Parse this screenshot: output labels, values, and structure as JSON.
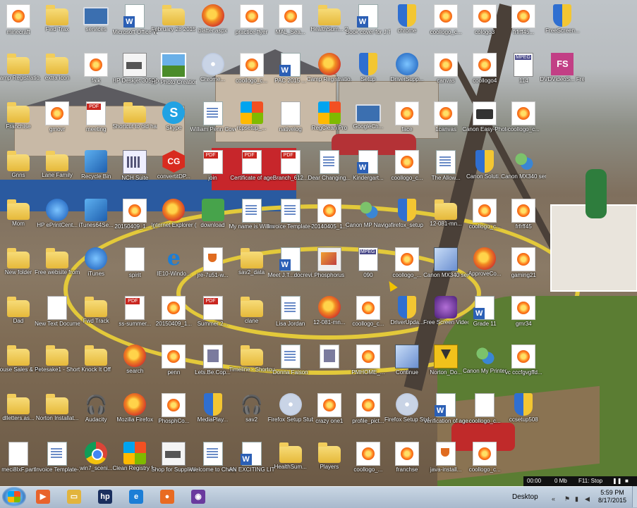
{
  "desktop": {
    "icons": [
      {
        "label": "minecraft",
        "icon": "coollogo-icon"
      },
      {
        "label": "Fwd Trax",
        "icon": "folder-icon"
      },
      {
        "label": "services",
        "icon": "monitor-icon"
      },
      {
        "label": "Microsoft Office Wo...",
        "icon": "word-icon"
      },
      {
        "label": "February 28 2015 Week...",
        "icon": "folder-icon"
      },
      {
        "label": "blatter.aspx",
        "icon": "firefox-icon"
      },
      {
        "label": "practice flyer",
        "icon": "coollogo-icon"
      },
      {
        "label": "MAL_Sea...",
        "icon": "coollogo-icon"
      },
      {
        "label": "HealthSum... 2",
        "icon": "folder-icon"
      },
      {
        "label": "Book cover for J.T. Hop...",
        "icon": "word-icon"
      },
      {
        "label": "chrome",
        "icon": "shield-icon"
      },
      {
        "label": "coollogo_c...",
        "icon": "coollogo-icon"
      },
      {
        "label": "cologo3",
        "icon": "coollogo-icon"
      },
      {
        "label": "frfrff45...",
        "icon": "coollogo-icon"
      },
      {
        "label": "FreeScreen...",
        "icon": "shield-icon"
      },
      {
        "label": "Camp Registratio...",
        "icon": "folder-icon"
      },
      {
        "label": "extra icon",
        "icon": "folder-icon"
      },
      {
        "label": "falk",
        "icon": "coollogo-icon"
      },
      {
        "label": "HP Deskjet 3050A J6...",
        "icon": "printer-icon"
      },
      {
        "label": "HP Photo Creations",
        "icon": "picture-icon"
      },
      {
        "label": "Chrome...",
        "icon": "disc-icon"
      },
      {
        "label": "coollogo_c...",
        "icon": "coollogo-icon"
      },
      {
        "label": "PAC 2015 ...",
        "icon": "word-icon"
      },
      {
        "label": "Camp Registratio...",
        "icon": "firefox-icon"
      },
      {
        "label": "Setup",
        "icon": "shield-icon"
      },
      {
        "label": "DriverSupp...",
        "icon": "blue-icon"
      },
      {
        "label": "canvas",
        "icon": "coollogo-icon"
      },
      {
        "label": "coollogo4",
        "icon": "coollogo-icon"
      },
      {
        "label": "114",
        "icon": "mpeg-icon"
      },
      {
        "label": "DVDVideoS... Free Studio",
        "icon": "pink-icon"
      },
      {
        "label": "Franchise",
        "icon": "folder-icon"
      },
      {
        "label": "gmovr",
        "icon": "coollogo-icon"
      },
      {
        "label": "meeting",
        "icon": "pdf-icon"
      },
      {
        "label": "Shortcut to old hard...",
        "icon": "folder-icon"
      },
      {
        "label": "Skype",
        "icon": "skype-icon"
      },
      {
        "label": "William Penn Cove...",
        "icon": "doc-icon"
      },
      {
        "label": "rcpsetup_...",
        "icon": "winlogo-icon"
      },
      {
        "label": "nativelog",
        "icon": "blankdoc-icon"
      },
      {
        "label": "RegClean Pro",
        "icon": "winlogo-icon"
      },
      {
        "label": "GoogleCh...",
        "icon": "monitor-icon"
      },
      {
        "label": "face",
        "icon": "coollogo-icon"
      },
      {
        "label": "1canvas",
        "icon": "coollogo-icon"
      },
      {
        "label": "Canon Easy-Photo...",
        "icon": "canon-icon"
      },
      {
        "label": "coollogo_c...",
        "icon": "coollogo-icon"
      },
      {
        "label": "",
        "icon": "none"
      },
      {
        "label": "Gnns",
        "icon": "folder-icon"
      },
      {
        "label": "Lane Family",
        "icon": "folder-icon"
      },
      {
        "label": "Recycle Bin",
        "icon": "exe-icon"
      },
      {
        "label": "NCH Suite",
        "icon": "calc-icon"
      },
      {
        "label": "convertitDP...",
        "icon": "cg-icon"
      },
      {
        "label": "join",
        "icon": "pdf-icon"
      },
      {
        "label": "Certificate of age",
        "icon": "pdf-icon"
      },
      {
        "label": "Branch_612...",
        "icon": "pdf-icon"
      },
      {
        "label": "Dear Changing...",
        "icon": "doc-icon"
      },
      {
        "label": "Kindergart...",
        "icon": "word-icon"
      },
      {
        "label": "coollogo_c...",
        "icon": "coollogo-icon"
      },
      {
        "label": "The Allow...",
        "icon": "doc-icon"
      },
      {
        "label": "Canon Soluti...",
        "icon": "shield-icon"
      },
      {
        "label": "Canon MX340 seri...",
        "icon": "people-icon"
      },
      {
        "label": "",
        "icon": "none"
      },
      {
        "label": "Mom",
        "icon": "folder-icon"
      },
      {
        "label": "HP ePrintCent...",
        "icon": "blue-icon"
      },
      {
        "label": "iTunes64Se...",
        "icon": "exe-icon"
      },
      {
        "label": "20150409_1... 1",
        "icon": "coollogo-icon"
      },
      {
        "label": "Internet Explorer (n...",
        "icon": "firefox-icon"
      },
      {
        "label": "download",
        "icon": "green-icon"
      },
      {
        "label": "My name is William Pe...",
        "icon": "doc-icon"
      },
      {
        "label": "Invoice Template-1",
        "icon": "doc-icon"
      },
      {
        "label": "20140405_1...",
        "icon": "coollogo-icon"
      },
      {
        "label": "Canon MP Navigator...",
        "icon": "people-icon"
      },
      {
        "label": "firefox_setup",
        "icon": "shield-icon"
      },
      {
        "label": "12-081-mn...",
        "icon": "folder-icon"
      },
      {
        "label": "coollogo_c...",
        "icon": "coollogo-icon"
      },
      {
        "label": "frfrff45",
        "icon": "coollogo-icon"
      },
      {
        "label": "",
        "icon": "none"
      },
      {
        "label": "New folder",
        "icon": "folder-icon"
      },
      {
        "label": "Free website from online",
        "icon": "folder-icon"
      },
      {
        "label": "iTunes",
        "icon": "blue-icon"
      },
      {
        "label": "spirit",
        "icon": "blankdoc-icon"
      },
      {
        "label": "IE10-Windo...",
        "icon": "ie-icon"
      },
      {
        "label": "jre-7u51-w...",
        "icon": "java-icon"
      },
      {
        "label": "sav2_data",
        "icon": "folder-icon"
      },
      {
        "label": "Meet J.T...docrevi...",
        "icon": "word-icon"
      },
      {
        "label": "Phosphorus",
        "icon": "image-icon"
      },
      {
        "label": "090",
        "icon": "mpeg-icon"
      },
      {
        "label": "coollogo_...",
        "icon": "coollogo-icon"
      },
      {
        "label": "Canon MX340 seri...",
        "icon": "net-icon"
      },
      {
        "label": "ApproveCo...",
        "icon": "firefox-icon"
      },
      {
        "label": "gaming21",
        "icon": "coollogo-icon"
      },
      {
        "label": "",
        "icon": "none"
      },
      {
        "label": "Dad",
        "icon": "folder-icon"
      },
      {
        "label": "New Text Document",
        "icon": "blankdoc-icon"
      },
      {
        "label": "Fwd Track",
        "icon": "folder-icon"
      },
      {
        "label": "ss-summer...",
        "icon": "pdf-icon"
      },
      {
        "label": "20150409_1...",
        "icon": "coollogo-icon"
      },
      {
        "label": "Summer 2...",
        "icon": "pdf-icon"
      },
      {
        "label": "clane",
        "icon": "folder-icon"
      },
      {
        "label": "Lisa Jordan",
        "icon": "doc-icon"
      },
      {
        "label": "12-081-mn...",
        "icon": "firefox-icon"
      },
      {
        "label": "coollogo_c...",
        "icon": "coollogo-icon"
      },
      {
        "label": "DriverUpda...",
        "icon": "shield-icon"
      },
      {
        "label": "Free Screen Video Re...",
        "icon": "purple-icon"
      },
      {
        "label": "Grade 11",
        "icon": "word-icon"
      },
      {
        "label": "gmr34",
        "icon": "coollogo-icon"
      },
      {
        "label": "",
        "icon": "none"
      },
      {
        "label": "House Sales & Purchases",
        "icon": "folder-icon"
      },
      {
        "label": "Petesake1 - Shortcut",
        "icon": "folder-icon"
      },
      {
        "label": "Knock It Off",
        "icon": "folder-icon"
      },
      {
        "label": "search",
        "icon": "firefox-icon"
      },
      {
        "label": "penn",
        "icon": "coollogo-icon"
      },
      {
        "label": "Lets.Be.Cop...",
        "icon": "media-icon"
      },
      {
        "label": "Timeline - Shortcut (2)",
        "icon": "folder-icon"
      },
      {
        "label": "Donna Faison",
        "icon": "doc-icon"
      },
      {
        "label": "",
        "icon": "media-icon"
      },
      {
        "label": "PMHOME_...",
        "icon": "coollogo-icon"
      },
      {
        "label": "Continue",
        "icon": "net-icon"
      },
      {
        "label": "Norton_Do...",
        "icon": "download-icon"
      },
      {
        "label": "Canon My Printer",
        "icon": "people-icon"
      },
      {
        "label": "vc cccfgvgffd...",
        "icon": "coollogo-icon"
      },
      {
        "label": "",
        "icon": "none"
      },
      {
        "label": "dlletters.as...",
        "icon": "folder-icon"
      },
      {
        "label": "Norton Installat...",
        "icon": "folder-icon"
      },
      {
        "label": "Audacity",
        "icon": "headphones-icon"
      },
      {
        "label": "Mozilla Firefox",
        "icon": "firefox-icon"
      },
      {
        "label": "PhosphCo...",
        "icon": "coollogo-icon"
      },
      {
        "label": "MediaPlay...",
        "icon": "shield-icon"
      },
      {
        "label": "sav2",
        "icon": "headphones-icon"
      },
      {
        "label": "Firefox Setup Stub 34.0.5",
        "icon": "disc-icon"
      },
      {
        "label": "crazy one1",
        "icon": "coollogo-icon"
      },
      {
        "label": "profile_pict...",
        "icon": "coollogo-icon"
      },
      {
        "label": "Firefox Setup Stub 38.0.1",
        "icon": "disc-icon"
      },
      {
        "label": "Verification of age",
        "icon": "word-icon"
      },
      {
        "label": "coollogo_c...",
        "icon": "blankdoc-icon"
      },
      {
        "label": "ccsetup508",
        "icon": "shield-icon"
      },
      {
        "label": "",
        "icon": "none"
      },
      {
        "label": "meci8IxF.part",
        "icon": "blankdoc-icon"
      },
      {
        "label": "Invoice Template-...",
        "icon": "doc-icon"
      },
      {
        "label": "win7_sceni...",
        "icon": "chrome-icon"
      },
      {
        "label": "Clean Registry f...",
        "icon": "winlogo-icon"
      },
      {
        "label": "Shop for Supplies -...",
        "icon": "printer-icon"
      },
      {
        "label": "Welcome to Changing...",
        "icon": "doc-icon"
      },
      {
        "label": "AN EXCITING LITTLE CAR...",
        "icon": "word-icon"
      },
      {
        "label": "HealthSum...",
        "icon": "folder-icon"
      },
      {
        "label": "Players",
        "icon": "folder-icon"
      },
      {
        "label": "coollogo_...",
        "icon": "coollogo-icon"
      },
      {
        "label": "franchse",
        "icon": "coollogo-icon"
      },
      {
        "label": "java-install...",
        "icon": "java-icon"
      },
      {
        "label": "coollogo_c...",
        "icon": "coollogo-icon"
      },
      {
        "label": "",
        "icon": "none"
      },
      {
        "label": "",
        "icon": "none"
      }
    ]
  },
  "recorder": {
    "time": "00:00",
    "size": "0 Mb",
    "stop": "F11: Stop"
  },
  "taskbar": {
    "start_label": "Start",
    "pinned": [
      {
        "icon": "media-player-icon",
        "glyph": "▶",
        "color": "#e8632b"
      },
      {
        "icon": "explorer-folder-icon",
        "glyph": "▭",
        "color": "#e2b43d"
      },
      {
        "icon": "hp-icon",
        "glyph": "hp",
        "color": "#1a2f5e"
      },
      {
        "icon": "internet-explorer-icon",
        "glyph": "e",
        "color": "#1c7ed6"
      },
      {
        "icon": "firefox-icon",
        "glyph": "●",
        "color": "#e86b22"
      },
      {
        "icon": "screen-recorder-icon",
        "glyph": "◉",
        "color": "#6a3a9e"
      }
    ],
    "desktop_label": "Desktop",
    "time": "5:59 PM",
    "date": "8/17/2015"
  }
}
